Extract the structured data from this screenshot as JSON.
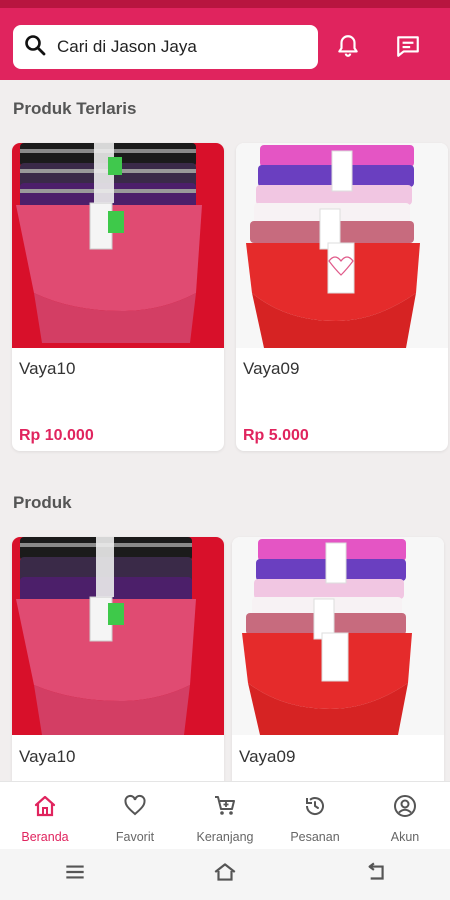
{
  "search": {
    "placeholder": "Cari di Jason Jaya"
  },
  "header": {
    "icons": [
      "bell-icon",
      "chat-icon"
    ]
  },
  "sections": {
    "bestseller_title": "Produk Terlaris",
    "products_title": "Produk"
  },
  "bestseller": [
    {
      "name": "Vaya10",
      "price": "Rp 10.000"
    },
    {
      "name": "Vaya09",
      "price": "Rp 5.000"
    }
  ],
  "products": [
    {
      "name": "Vaya10"
    },
    {
      "name": "Vaya09"
    }
  ],
  "nav": {
    "items": [
      {
        "label": "Beranda",
        "icon": "home-icon",
        "active": true
      },
      {
        "label": "Favorit",
        "icon": "heart-icon"
      },
      {
        "label": "Keranjang",
        "icon": "cart-icon"
      },
      {
        "label": "Pesanan",
        "icon": "history-icon"
      },
      {
        "label": "Akun",
        "icon": "account-icon"
      }
    ]
  },
  "colors": {
    "primary": "#e0245e",
    "status_bar": "#b8153f",
    "background": "#f1eeee"
  }
}
